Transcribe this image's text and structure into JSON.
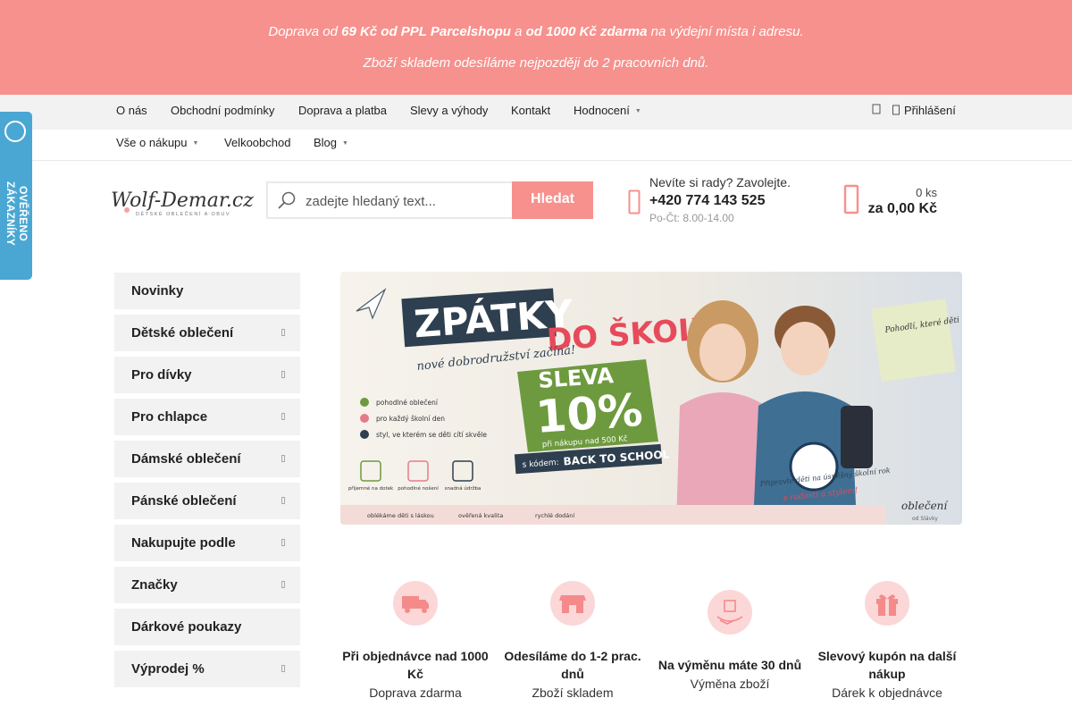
{
  "banner": {
    "line1_pre": "Doprava od ",
    "line1_b1": "69 Kč od PPL Parcelshopu",
    "line1_mid": " a ",
    "line1_b2": "od 1000 Kč zdarma",
    "line1_post": " na výdejní místa i adresu.",
    "line2": "Zboží skladem odesíláme nejpozději do 2 pracovních dnů."
  },
  "nav_top": {
    "items": [
      "O nás",
      "Obchodní podmínky",
      "Doprava a platba",
      "Slevy a výhody",
      "Kontakt",
      "Hodnocení"
    ],
    "login": "Přihlášení"
  },
  "nav_second": {
    "items": [
      "Vše o nákupu",
      "Velkoobchod",
      "Blog"
    ]
  },
  "logo": {
    "name": "Wolf-Demar.cz",
    "tagline": "DĚTSKÉ OBLEČENÍ A OBUV"
  },
  "search": {
    "placeholder": "zadejte hledaný text...",
    "button": "Hledat"
  },
  "help": {
    "question": "Nevíte si rady? Zavolejte.",
    "phone": "+420 774 143 525",
    "hours": "Po-Čt: 8.00-14.00"
  },
  "cart": {
    "count": "0 ks",
    "total": "za 0,00 Kč"
  },
  "verified_badge": {
    "text": "OVĚŘENO ZÁKAZNÍKY"
  },
  "sidebar": {
    "categories": [
      {
        "label": "Novinky",
        "has_sub": false
      },
      {
        "label": "Dětské oblečení",
        "has_sub": true
      },
      {
        "label": "Pro dívky",
        "has_sub": true
      },
      {
        "label": "Pro chlapce",
        "has_sub": true
      },
      {
        "label": "Dámské oblečení",
        "has_sub": true
      },
      {
        "label": "Pánské oblečení",
        "has_sub": true
      },
      {
        "label": "Nakupujte podle",
        "has_sub": true
      },
      {
        "label": "Značky",
        "has_sub": true
      },
      {
        "label": "Dárkové poukazy",
        "has_sub": false
      },
      {
        "label": "Výprodej %",
        "has_sub": true
      }
    ]
  },
  "hero": {
    "title1": "ZPÁTKY",
    "title2": "DO ŠKOLY",
    "subtitle": "nové dobrodružství začíná!",
    "sale": "SLEVA",
    "percent": "10%",
    "condition": "při nákupu nad 500 Kč",
    "code_label": "s kódem:",
    "code": "BACK TO SCHOOL",
    "bullets": [
      "pohodlné oblečení",
      "pro každý školní den",
      "styl, ve kterém se děti cítí skvěle"
    ],
    "props": [
      "příjemné na dotek",
      "pohodlné nošení",
      "snadná údržba"
    ],
    "note": "Pohodlí, které děti milují. Každý den.",
    "tagline1": "Připravte děti na úspěšný školní rok",
    "tagline2": "s radostí a stylem!",
    "footer": [
      "oblékáme děti s láskou",
      "ověřená kvalita",
      "rychlé dodání"
    ],
    "brand": "oblečení",
    "brand_sub": "od Slávky"
  },
  "features": [
    {
      "title": "Při objednávce nad 1000 Kč",
      "sub": "Doprava zdarma",
      "icon": "truck-icon"
    },
    {
      "title": "Odesíláme do 1-2 prac. dnů",
      "sub": "Zboží skladem",
      "icon": "shop-icon"
    },
    {
      "title": "Na výměnu máte 30 dnů",
      "sub": "Výměna zboží",
      "icon": "exchange-icon"
    },
    {
      "title": "Slevový kupón na další nákup",
      "sub": "Dárek k objednávce",
      "icon": "gift-icon"
    }
  ],
  "colors": {
    "accent": "#f7918d",
    "verified": "#4aa7d3",
    "sidebar_bg": "#f2f2f2"
  }
}
